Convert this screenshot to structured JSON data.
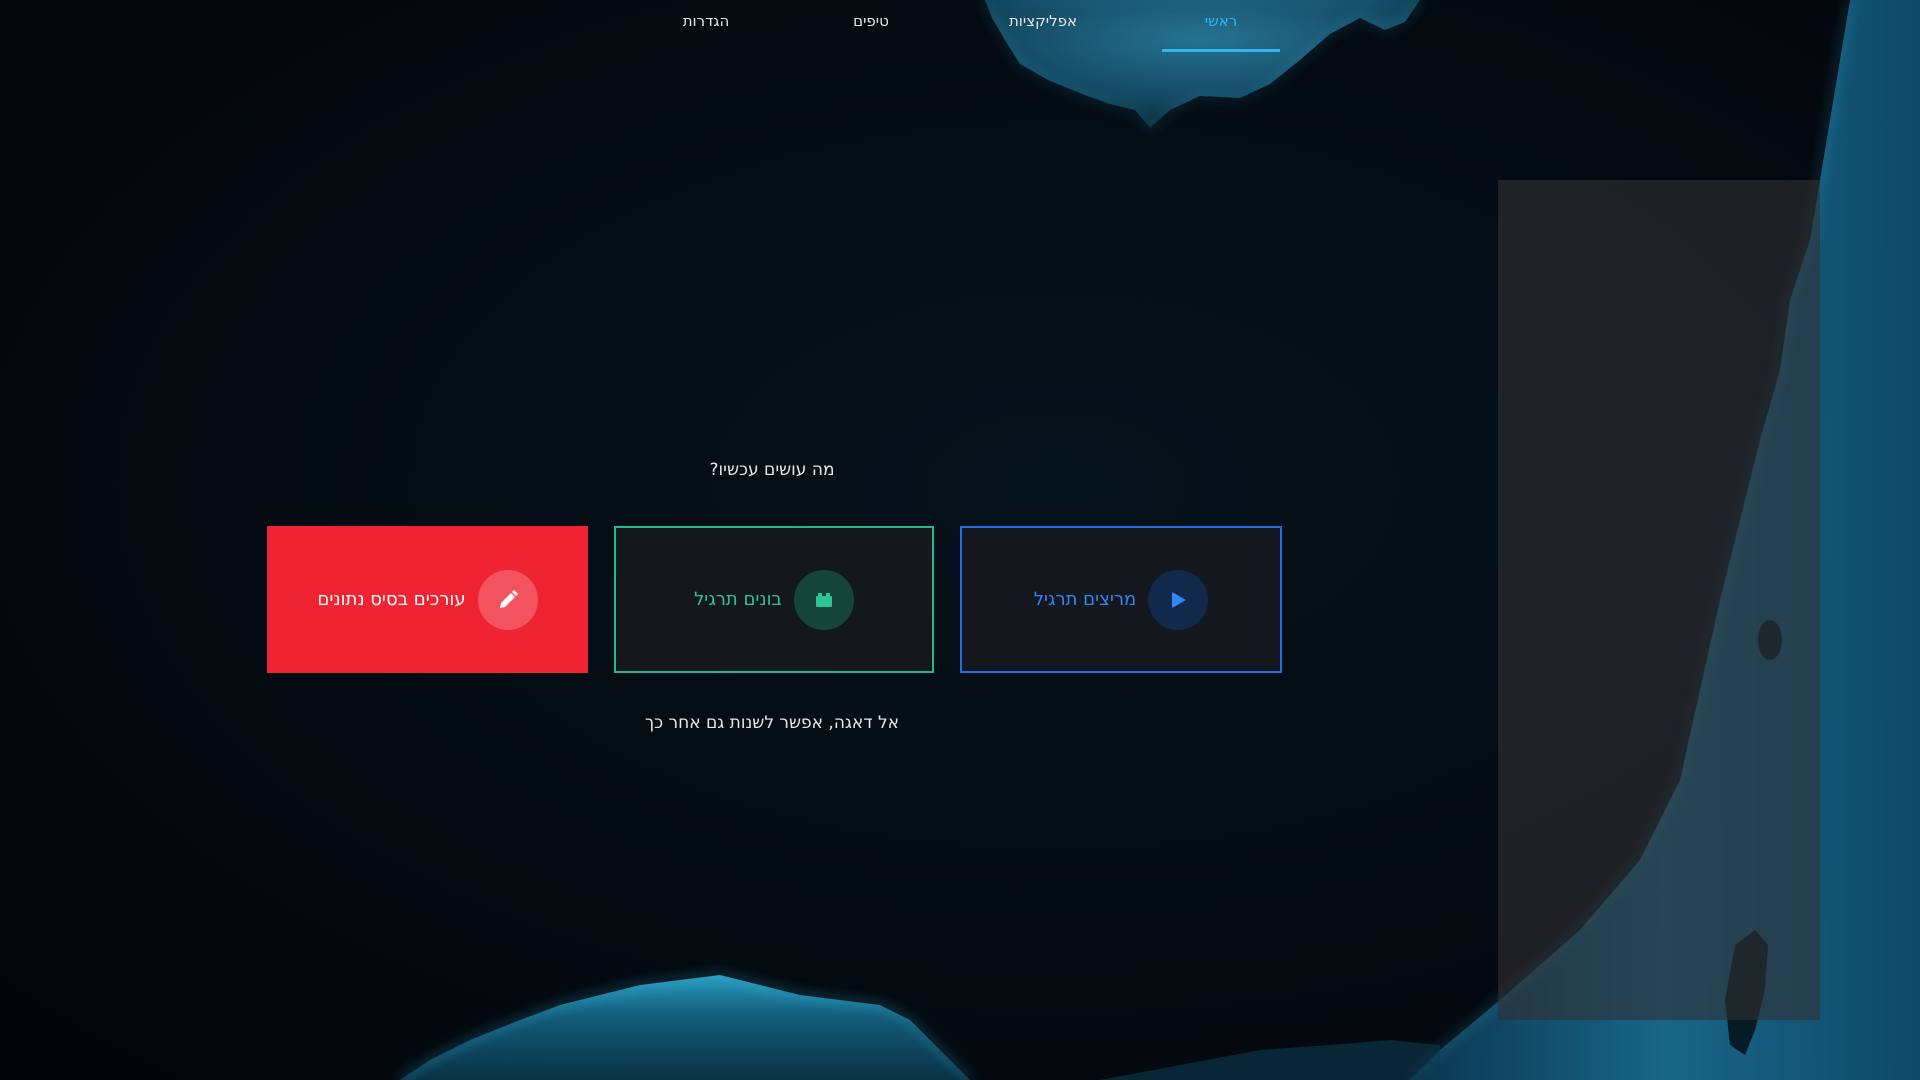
{
  "nav": {
    "items": [
      {
        "label": "ראשי",
        "active": true
      },
      {
        "label": "אפליקציות",
        "active": false
      },
      {
        "label": "טיפים",
        "active": false
      },
      {
        "label": "הגדרות",
        "active": false
      }
    ]
  },
  "main": {
    "question": "מה עושים עכשיו?",
    "cards": [
      {
        "label": "מריצים תרגיל",
        "icon": "play-icon",
        "color": "#1f6fe0"
      },
      {
        "label": "בונים תרגיל",
        "icon": "blocks-icon",
        "color": "#23b98a"
      },
      {
        "label": "עורכים בסיס נתונים",
        "icon": "pencil-icon",
        "color": "#ef2332"
      }
    ],
    "note": "אל דאגה, אפשר לשנות גם אחר כך"
  },
  "colors": {
    "accent": "#2fb8f0",
    "background": "#03070c"
  }
}
